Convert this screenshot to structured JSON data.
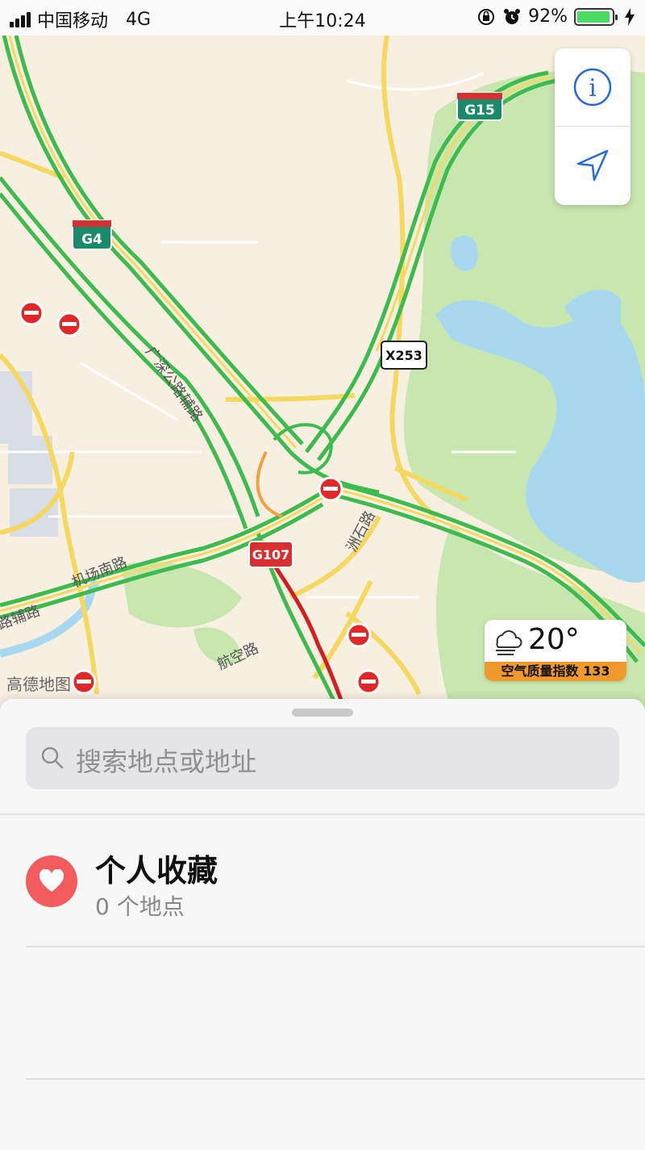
{
  "status_bar": {
    "carrier": "中国移动",
    "network": "4G",
    "time": "上午10:24",
    "battery_percent": "92%",
    "battery_level": 0.92
  },
  "map": {
    "road_shields": [
      "G15",
      "G4",
      "X253",
      "G107"
    ],
    "road_labels": [
      "广深公路辅路",
      "机场南路",
      "洲石路",
      "航空路",
      "路辅路"
    ],
    "watermark": "高德地图",
    "colors": {
      "land": "#f7efe0",
      "water": "#a8d8f0",
      "park": "#c8e6b0",
      "traffic_green": "#3dbb4e",
      "traffic_red": "#d02020",
      "road_yellow": "#f5d860"
    }
  },
  "map_controls": {
    "info_icon": "info-icon",
    "locate_icon": "location-arrow-icon"
  },
  "weather": {
    "temperature": "20°",
    "aqi_label": "空气质量指数 133",
    "icon": "cloud-fog-icon"
  },
  "search": {
    "placeholder": "搜索地点或地址"
  },
  "favorites": {
    "title": "个人收藏",
    "subtitle": "0 个地点",
    "icon": "heart-icon"
  }
}
